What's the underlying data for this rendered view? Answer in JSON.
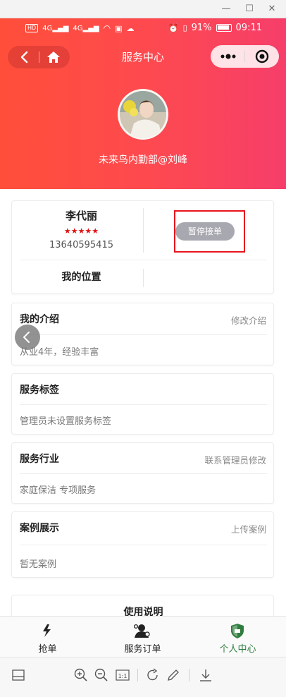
{
  "window": {
    "minimize_glyph": "—",
    "maximize_glyph": "☐",
    "close_glyph": "✕"
  },
  "status_bar": {
    "left_chip": "HD",
    "network_1": "4G",
    "network_2": "4G",
    "battery_percent": "91%",
    "time": "09:11"
  },
  "header": {
    "title": "服务中心",
    "back_icon": "chevron-left-icon",
    "home_icon": "home-icon",
    "more_icon": "more-dots-icon",
    "close_icon": "target-circle-icon"
  },
  "profile": {
    "nickname": "未来鸟内勤部@刘峰"
  },
  "worker": {
    "name": "李代丽",
    "stars": "★★★★★",
    "rating": 5,
    "phone": "13640595415",
    "pause_button": "暂停接单",
    "location_label": "我的位置",
    "location_value": ""
  },
  "sections": {
    "intro": {
      "title": "我的介绍",
      "action": "修改介绍",
      "text": "从业4年，经验丰富"
    },
    "tags": {
      "title": "服务标签",
      "text": "管理员未设置服务标签"
    },
    "industry": {
      "title": "服务行业",
      "action": "联系管理员修改",
      "text": "家庭保洁 专项服务"
    },
    "cases": {
      "title": "案例展示",
      "action": "上传案例",
      "text": "暂无案例"
    },
    "instructions": {
      "title": "使用说明"
    }
  },
  "tabbar": {
    "tabs": [
      {
        "label": "抢单",
        "icon": "lightning-icon",
        "active": false
      },
      {
        "label": "服务订单",
        "icon": "service-person-icon",
        "active": false
      },
      {
        "label": "个人中心",
        "icon": "shield-icon",
        "active": true
      }
    ],
    "active_color": "#2f7d3e"
  },
  "colors": {
    "header_gradient_start": "#ff4f3a",
    "header_gradient_end": "#f63e6a",
    "star_color": "#e01212",
    "highlight_border": "#e8141c",
    "pause_button_bg": "#a8a8b0"
  }
}
